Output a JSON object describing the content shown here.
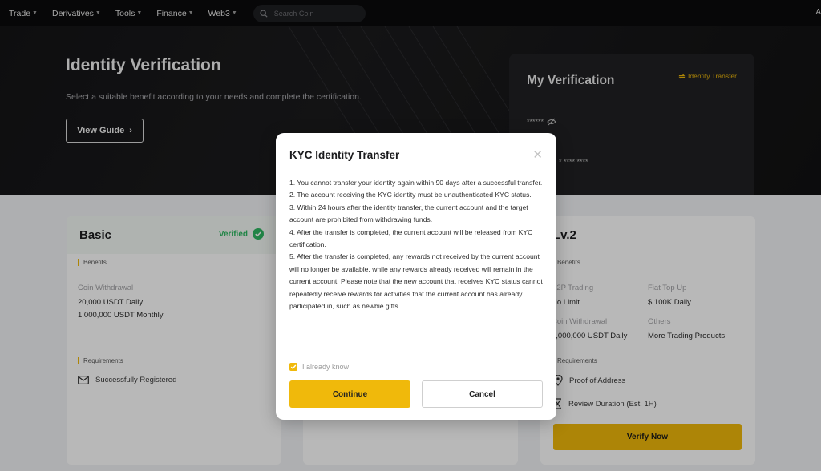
{
  "nav": {
    "items": [
      {
        "label": "Trade",
        "has_caret": true
      },
      {
        "label": "Derivatives",
        "has_caret": true
      },
      {
        "label": "Tools",
        "has_caret": true
      },
      {
        "label": "Finance",
        "has_caret": true
      },
      {
        "label": "Web3",
        "has_caret": true
      }
    ],
    "search_placeholder": "Search Coin",
    "right_text": "A"
  },
  "hero": {
    "title": "Identity Verification",
    "subtitle": "Select a suitable benefit according to your needs and complete the certification.",
    "guide_button": "View Guide",
    "my_verification": {
      "title": "My Verification",
      "transfer_link": "Identity Transfer",
      "masked_name": "******",
      "masked_id": "* **** ****"
    }
  },
  "cards": {
    "basic": {
      "name": "Basic",
      "status": "Verified",
      "benefits_label": "Benefits",
      "withdraw_label": "Coin Withdrawal",
      "withdraw_daily": "20,000 USDT Daily",
      "withdraw_monthly": "1,000,000 USDT Monthly",
      "requirements_label": "Requirements",
      "req_1": "Successfully Registered"
    },
    "lv2": {
      "name": "Lv.2",
      "benefits_label": "Benefits",
      "p2p_label": "P2P Trading",
      "p2p_value": "No Limit",
      "fiat_label": "Fiat Top Up",
      "fiat_value": "$ 100K Daily",
      "withdraw_label": "Coin Withdrawal",
      "withdraw_value": "1,000,000 USDT Daily",
      "others_label": "Others",
      "others_value": "More Trading Products",
      "requirements_label": "Requirements",
      "req_1": "Proof of Address",
      "req_2": "Review Duration (Est. 1H)",
      "verify_button": "Verify Now"
    }
  },
  "modal": {
    "title": "KYC Identity Transfer",
    "rules": [
      "1. You cannot transfer your identity again within 90 days after a successful transfer.",
      "2. The account receiving the KYC identity must be unauthenticated KYC status.",
      "3. Within 24 hours after the identity transfer, the current account and the target account are prohibited from withdrawing funds.",
      "4. After the transfer is completed, the current account will be released from KYC certification.",
      "5. After the transfer is completed, any rewards not received by the current account will no longer be available, while any rewards already received will remain in the current account. Please note that the new account that receives KYC status cannot repeatedly receive rewards for activities that the current account has already participated in, such as newbie gifts."
    ],
    "checkbox_label": "I already know",
    "checkbox_checked": true,
    "continue_button": "Continue",
    "cancel_button": "Cancel"
  },
  "colors": {
    "accent": "#f0b90b",
    "verified": "#2db861",
    "nav_bg": "#0b0b0c"
  }
}
